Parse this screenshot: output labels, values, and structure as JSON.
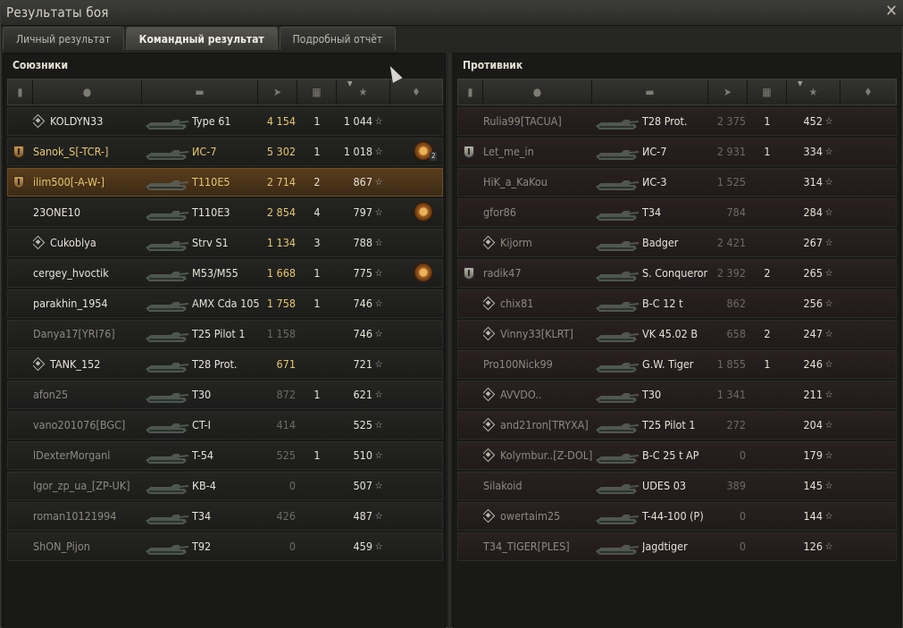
{
  "window": {
    "title": "Результаты боя"
  },
  "tabs": [
    {
      "label": "Личный результат",
      "active": false
    },
    {
      "label": "Командный результат",
      "active": true
    },
    {
      "label": "Подробный отчёт",
      "active": false
    }
  ],
  "allies": {
    "title": "Союзники",
    "rows": [
      {
        "badge": "diamond",
        "name": "KOLDYN33",
        "tank": "Type 61",
        "damage": "4 154",
        "kills": "1",
        "xp": "1 044",
        "medal": "",
        "medal_count": "",
        "style": "white",
        "dmg_style": "gold"
      },
      {
        "badge": "squad",
        "name": "Sanok_S[-TCR-]",
        "tank": "ИС-7",
        "damage": "5 302",
        "kills": "1",
        "xp": "1 018",
        "medal": "medal",
        "medal_count": "2",
        "style": "gold",
        "dmg_style": "gold"
      },
      {
        "badge": "squad",
        "name": "ilim500[-A-W-]",
        "tank": "T110E5",
        "damage": "2 714",
        "kills": "2",
        "xp": "867",
        "medal": "",
        "medal_count": "",
        "style": "gold",
        "dmg_style": "gold",
        "me": true
      },
      {
        "badge": "",
        "name": "23ONE10",
        "tank": "T110E3",
        "damage": "2 854",
        "kills": "4",
        "xp": "797",
        "medal": "medal",
        "medal_count": "",
        "style": "white",
        "dmg_style": "gold"
      },
      {
        "badge": "diamond",
        "name": "Cukoblya",
        "tank": "Strv S1",
        "damage": "1 134",
        "kills": "3",
        "xp": "788",
        "medal": "",
        "medal_count": "",
        "style": "white",
        "dmg_style": "gold"
      },
      {
        "badge": "",
        "name": "cergey_hvoctik",
        "tank": "M53/M55",
        "damage": "1 668",
        "kills": "1",
        "xp": "775",
        "medal": "medal",
        "medal_count": "",
        "style": "white",
        "dmg_style": "gold"
      },
      {
        "badge": "",
        "name": "parakhin_1954",
        "tank": "AMX Cda 105",
        "damage": "1 758",
        "kills": "1",
        "xp": "746",
        "medal": "",
        "medal_count": "",
        "style": "white",
        "dmg_style": "gold"
      },
      {
        "badge": "",
        "name": "Danya17[YRI76]",
        "tank": "T25 Pilot 1",
        "damage": "1 158",
        "kills": "",
        "xp": "746",
        "medal": "",
        "medal_count": "",
        "style": "grey",
        "dmg_style": "dim"
      },
      {
        "badge": "diamond",
        "name": "TANK_152",
        "tank": "T28 Prot.",
        "damage": "671",
        "kills": "",
        "xp": "721",
        "medal": "",
        "medal_count": "",
        "style": "white",
        "dmg_style": "gold"
      },
      {
        "badge": "",
        "name": "afon25",
        "tank": "T30",
        "damage": "872",
        "kills": "1",
        "xp": "621",
        "medal": "",
        "medal_count": "",
        "style": "grey",
        "dmg_style": "dim"
      },
      {
        "badge": "",
        "name": "vano201076[BGC]",
        "tank": "CT-I",
        "damage": "414",
        "kills": "",
        "xp": "525",
        "medal": "",
        "medal_count": "",
        "style": "grey",
        "dmg_style": "dim"
      },
      {
        "badge": "",
        "name": "lDexterMorganl",
        "tank": "T-54",
        "damage": "525",
        "kills": "1",
        "xp": "510",
        "medal": "",
        "medal_count": "",
        "style": "grey",
        "dmg_style": "dim"
      },
      {
        "badge": "",
        "name": "Igor_zp_ua_[ZP-UK]",
        "tank": "КВ-4",
        "damage": "0",
        "kills": "",
        "xp": "507",
        "medal": "",
        "medal_count": "",
        "style": "grey",
        "dmg_style": "dim"
      },
      {
        "badge": "",
        "name": "roman10121994",
        "tank": "T34",
        "damage": "426",
        "kills": "",
        "xp": "487",
        "medal": "",
        "medal_count": "",
        "style": "grey",
        "dmg_style": "dim"
      },
      {
        "badge": "",
        "name": "ShON_Pijon",
        "tank": "T92",
        "damage": "0",
        "kills": "",
        "xp": "459",
        "medal": "",
        "medal_count": "",
        "style": "grey",
        "dmg_style": "dim"
      }
    ]
  },
  "enemies": {
    "title": "Противник",
    "rows": [
      {
        "badge": "",
        "name": "Rulia99[TACUA]",
        "tank": "T28 Prot.",
        "damage": "2 375",
        "kills": "1",
        "xp": "452",
        "style": "grey"
      },
      {
        "badge": "squad",
        "name": "Let_me_in",
        "tank": "ИС-7",
        "damage": "2 931",
        "kills": "1",
        "xp": "334",
        "style": "grey"
      },
      {
        "badge": "",
        "name": "HiK_a_KaKou",
        "tank": "ИС-3",
        "damage": "1 525",
        "kills": "",
        "xp": "314",
        "style": "grey"
      },
      {
        "badge": "",
        "name": "gfor86",
        "tank": "T34",
        "damage": "784",
        "kills": "",
        "xp": "284",
        "style": "grey"
      },
      {
        "badge": "diamond",
        "name": "Kijorm",
        "tank": "Badger",
        "damage": "2 421",
        "kills": "",
        "xp": "267",
        "style": "grey"
      },
      {
        "badge": "squad",
        "name": "radik47",
        "tank": "S. Conqueror",
        "damage": "2 392",
        "kills": "2",
        "xp": "265",
        "style": "grey"
      },
      {
        "badge": "diamond",
        "name": "chix81",
        "tank": "B-C 12 t",
        "damage": "862",
        "kills": "",
        "xp": "256",
        "style": "grey"
      },
      {
        "badge": "diamond",
        "name": "Vinny33[KLRT]",
        "tank": "VK 45.02 B",
        "damage": "658",
        "kills": "2",
        "xp": "247",
        "style": "grey"
      },
      {
        "badge": "",
        "name": "Pro100Nick99",
        "tank": "G.W. Tiger",
        "damage": "1 855",
        "kills": "1",
        "xp": "246",
        "style": "grey"
      },
      {
        "badge": "diamond",
        "name": "AVVDO..",
        "tank": "T30",
        "damage": "1 341",
        "kills": "",
        "xp": "211",
        "style": "grey"
      },
      {
        "badge": "diamond",
        "name": "and21ron[TRYXA]",
        "tank": "T25 Pilot 1",
        "damage": "272",
        "kills": "",
        "xp": "204",
        "style": "grey"
      },
      {
        "badge": "diamond",
        "name": "Kolymbur..[Z-DOL]",
        "tank": "B-C 25 t AP",
        "damage": "0",
        "kills": "",
        "xp": "179",
        "style": "grey"
      },
      {
        "badge": "",
        "name": "Silakoid",
        "tank": "UDES 03",
        "damage": "389",
        "kills": "",
        "xp": "145",
        "style": "grey"
      },
      {
        "badge": "diamond",
        "name": "owertaim25",
        "tank": "T-44-100 (P)",
        "damage": "0",
        "kills": "",
        "xp": "144",
        "style": "grey"
      },
      {
        "badge": "",
        "name": "T34_TIGER[PLES]",
        "tank": "Jagdtiger",
        "damage": "0",
        "kills": "",
        "xp": "126",
        "style": "grey"
      }
    ]
  },
  "columns_icons": [
    "squad-icon",
    "player-icon",
    "tank-icon",
    "damage-icon",
    "kills-icon",
    "xp-star-icon",
    "medal-icon"
  ],
  "colors": {
    "accent_gold": "#e5c86b",
    "self_row": "#5a3d1c",
    "enemy_row": "#2a2121"
  }
}
